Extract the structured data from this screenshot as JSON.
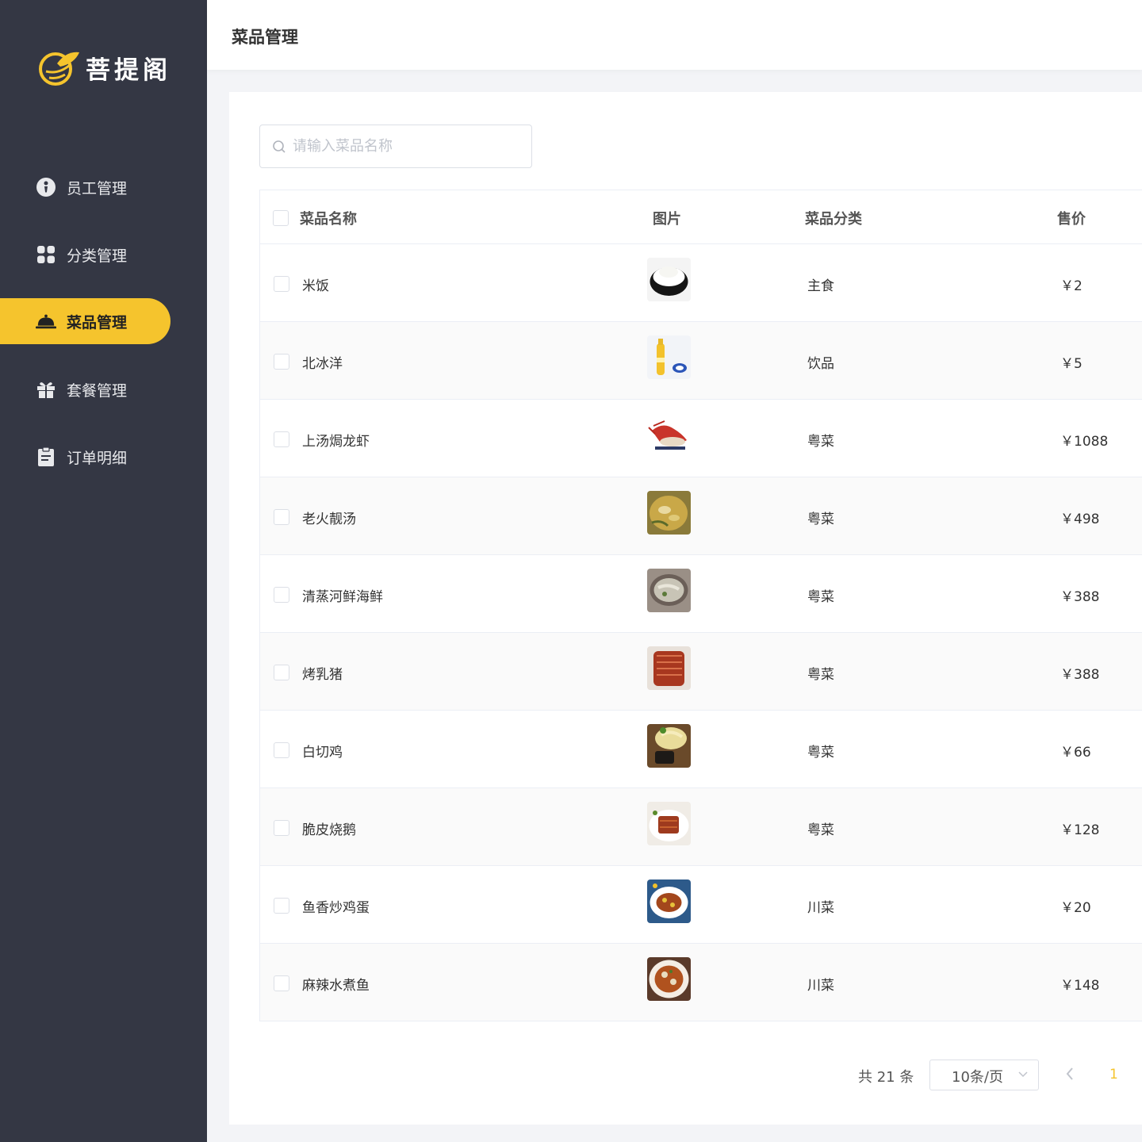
{
  "brand": {
    "name": "菩提阁",
    "accent": "#f5c42d",
    "sidebar_bg": "#343744"
  },
  "sidebar": {
    "items": [
      {
        "label": "员工管理",
        "icon": "employee-icon",
        "active": false
      },
      {
        "label": "分类管理",
        "icon": "category-icon",
        "active": false
      },
      {
        "label": "菜品管理",
        "icon": "dish-cloche-icon",
        "active": true
      },
      {
        "label": "套餐管理",
        "icon": "gift-icon",
        "active": false
      },
      {
        "label": "订单明细",
        "icon": "clipboard-icon",
        "active": false
      }
    ]
  },
  "header": {
    "title": "菜品管理"
  },
  "search": {
    "placeholder": "请输入菜品名称",
    "value": ""
  },
  "table": {
    "columns": [
      "菜品名称",
      "图片",
      "菜品分类",
      "售价"
    ],
    "rows": [
      {
        "name": "米饭",
        "category": "主食",
        "price": "￥2",
        "image": "rice"
      },
      {
        "name": "北冰洋",
        "category": "饮品",
        "price": "￥5",
        "image": "soda"
      },
      {
        "name": "上汤焗龙虾",
        "category": "粤菜",
        "price": "￥1088",
        "image": "lobster"
      },
      {
        "name": "老火靓汤",
        "category": "粤菜",
        "price": "￥498",
        "image": "soup"
      },
      {
        "name": "清蒸河鲜海鲜",
        "category": "粤菜",
        "price": "￥388",
        "image": "seafood"
      },
      {
        "name": "烤乳猪",
        "category": "粤菜",
        "price": "￥388",
        "image": "roast-pig"
      },
      {
        "name": "白切鸡",
        "category": "粤菜",
        "price": "￥66",
        "image": "chicken"
      },
      {
        "name": "脆皮烧鹅",
        "category": "粤菜",
        "price": "￥128",
        "image": "goose"
      },
      {
        "name": "鱼香炒鸡蛋",
        "category": "川菜",
        "price": "￥20",
        "image": "egg"
      },
      {
        "name": "麻辣水煮鱼",
        "category": "川菜",
        "price": "￥148",
        "image": "fish"
      }
    ]
  },
  "pagination": {
    "total_text": "共 21 条",
    "page_size": "10条/页",
    "current_page": "1"
  }
}
